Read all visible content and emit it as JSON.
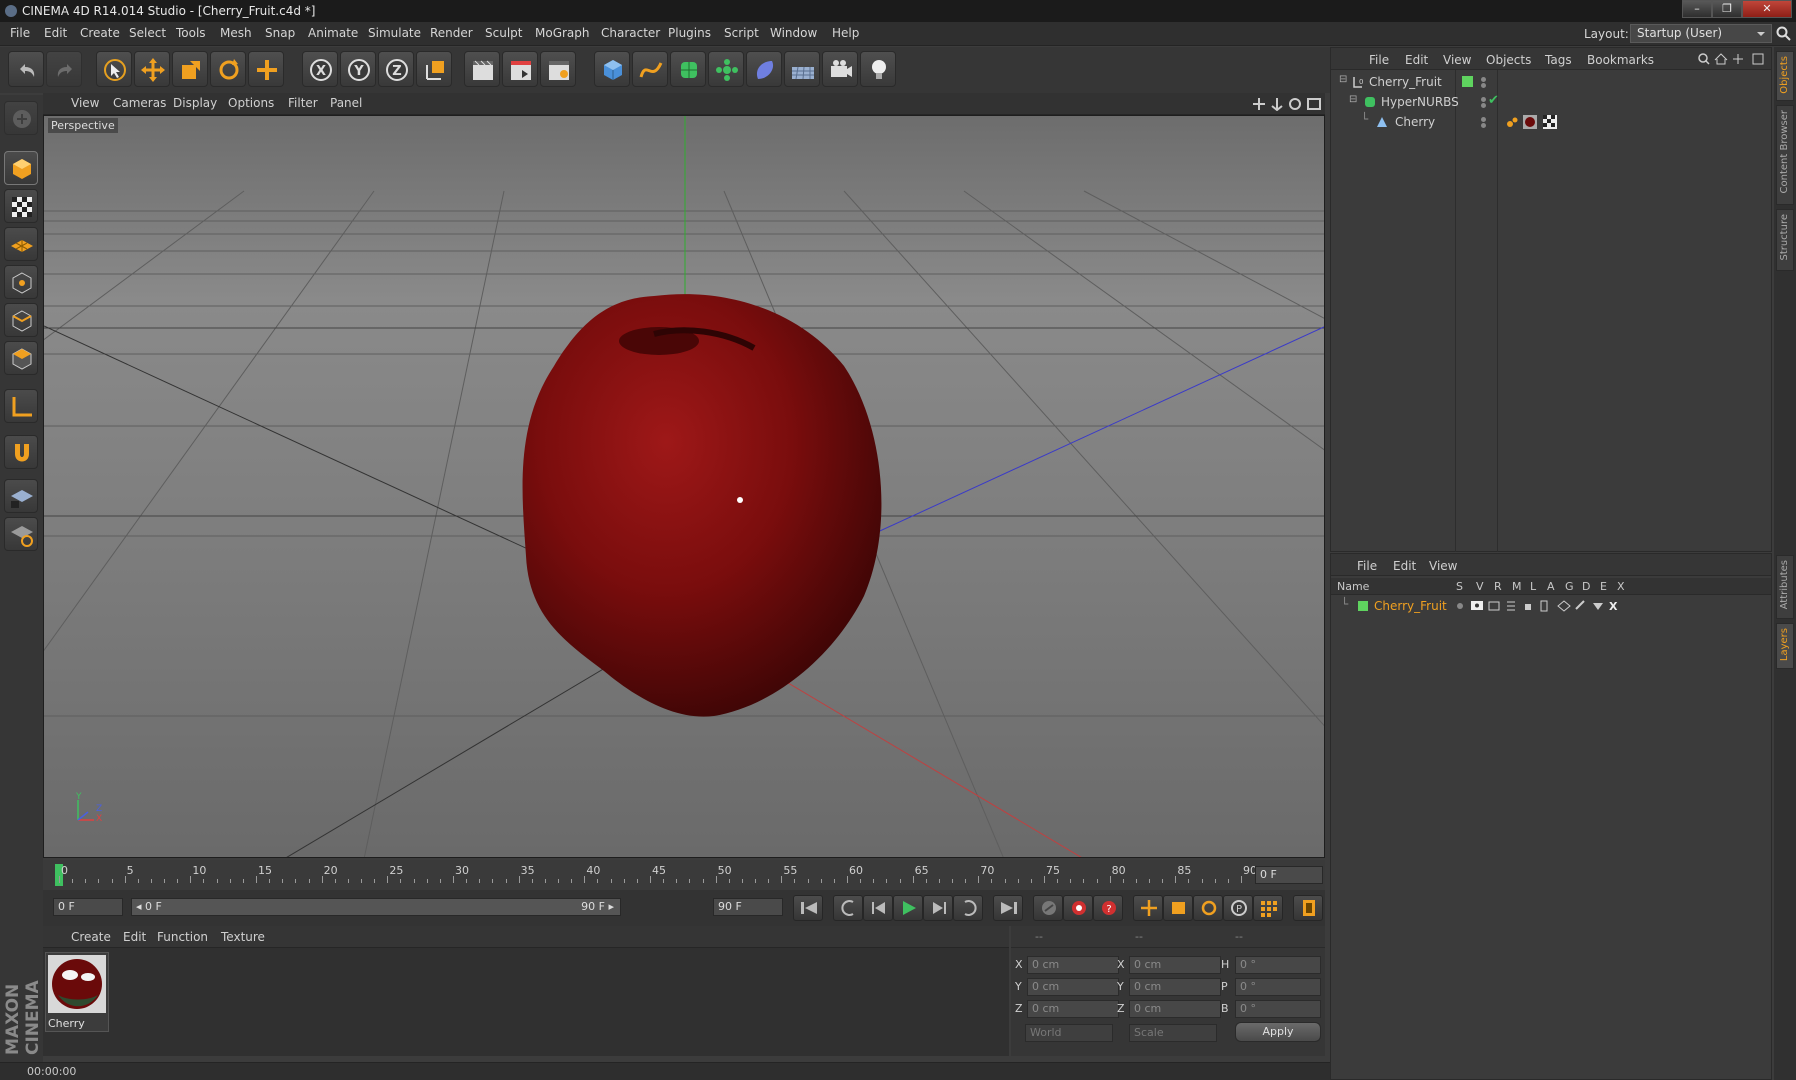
{
  "window": {
    "title": "CINEMA 4D R14.014 Studio - [Cherry_Fruit.c4d *]",
    "controls": [
      "–",
      "❐",
      "✕"
    ]
  },
  "menubar": {
    "items": [
      "File",
      "Edit",
      "Create",
      "Select",
      "Tools",
      "Mesh",
      "Snap",
      "Animate",
      "Simulate",
      "Render",
      "Sculpt",
      "MoGraph",
      "Character",
      "Plugins",
      "Script",
      "Window",
      "Help"
    ],
    "layout_label": "Layout:",
    "layout_value": "Startup (User)"
  },
  "viewport": {
    "menu": [
      "View",
      "Cameras",
      "Display",
      "Options",
      "Filter",
      "Panel"
    ],
    "label": "Perspective",
    "axis_labels": {
      "y": "Y",
      "x": "X",
      "z": "Z"
    }
  },
  "timeline": {
    "ticks": [
      "0",
      "5",
      "10",
      "15",
      "20",
      "25",
      "30",
      "35",
      "40",
      "45",
      "50",
      "55",
      "60",
      "65",
      "70",
      "75",
      "80",
      "85",
      "90"
    ],
    "end_field": "0 F"
  },
  "transport": {
    "current_frame": "0 F",
    "range_start": "◂ 0 F",
    "range_end": "90 F ▸",
    "max_frame": "90 F"
  },
  "materials": {
    "menu": [
      "Create",
      "Edit",
      "Function",
      "Texture"
    ],
    "items": [
      {
        "name": "Cherry"
      }
    ]
  },
  "coordinates": {
    "header": [
      "--",
      "--",
      "--"
    ],
    "rows": [
      {
        "a_label": "X",
        "a_val": "0 cm",
        "b_label": "X",
        "b_val": "0 cm",
        "c_label": "H",
        "c_val": "0 °"
      },
      {
        "a_label": "Y",
        "a_val": "0 cm",
        "b_label": "Y",
        "b_val": "0 cm",
        "c_label": "P",
        "c_val": "0 °"
      },
      {
        "a_label": "Z",
        "a_val": "0 cm",
        "b_label": "Z",
        "b_val": "0 cm",
        "c_label": "B",
        "c_val": "0 °"
      }
    ],
    "space": "World",
    "mode": "Scale",
    "apply": "Apply"
  },
  "status": {
    "time": "00:00:00"
  },
  "objects_panel": {
    "menu": [
      "File",
      "Edit",
      "View",
      "Objects",
      "Tags",
      "Bookmarks"
    ],
    "tree": [
      {
        "name": "Cherry_Fruit",
        "type": "null"
      },
      {
        "name": "HyperNURBS",
        "type": "hypernurbs"
      },
      {
        "name": "Cherry",
        "type": "polygon"
      }
    ]
  },
  "layers_panel": {
    "menu": [
      "File",
      "Edit",
      "View"
    ],
    "columns": [
      "Name",
      "S",
      "V",
      "R",
      "M",
      "L",
      "A",
      "G",
      "D",
      "E",
      "X"
    ],
    "layers": [
      {
        "name": "Cherry_Fruit",
        "color": "#5fd35f"
      }
    ]
  },
  "side_tabs": [
    "Objects",
    "Content Browser",
    "Structure",
    "Attributes",
    "Layers"
  ],
  "colors": {
    "accent_orange": "#f0a020",
    "layer_green": "#5fd35f",
    "cherry": "#8a1010"
  }
}
